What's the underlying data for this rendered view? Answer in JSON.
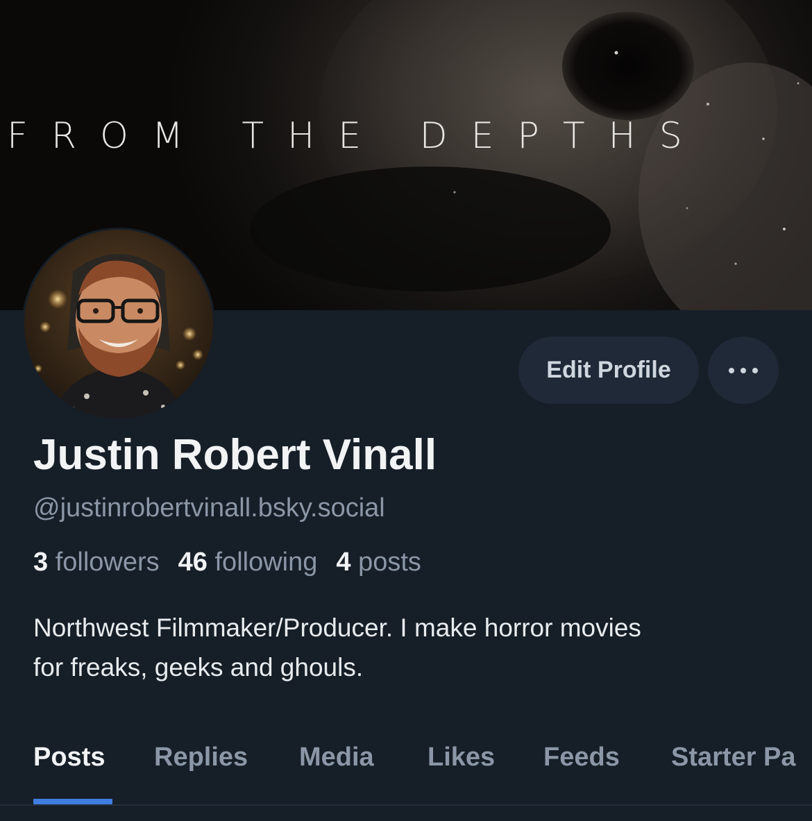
{
  "banner": {
    "text": "FROM THE DEPTHS"
  },
  "profile": {
    "name": "Justin Robert Vinall",
    "handle": "@justinrobertvinall.bsky.social",
    "bio_line1": "Northwest Filmmaker/Producer. I make horror movies",
    "bio_line2": "for freaks, geeks and ghouls."
  },
  "stats": {
    "followers_count": "3",
    "followers_label": "followers",
    "following_count": "46",
    "following_label": "following",
    "posts_count": "4",
    "posts_label": "posts"
  },
  "actions": {
    "edit_label": "Edit Profile",
    "more_icon": "ellipsis-icon"
  },
  "tabs": [
    {
      "label": "Posts",
      "active": true
    },
    {
      "label": "Replies"
    },
    {
      "label": "Media"
    },
    {
      "label": "Likes"
    },
    {
      "label": "Feeds"
    },
    {
      "label": "Starter Pa"
    }
  ],
  "colors": {
    "background": "#161e27",
    "accent": "#3f7ee0",
    "button_bg": "#1f2937",
    "muted_text": "#8b97a6"
  }
}
